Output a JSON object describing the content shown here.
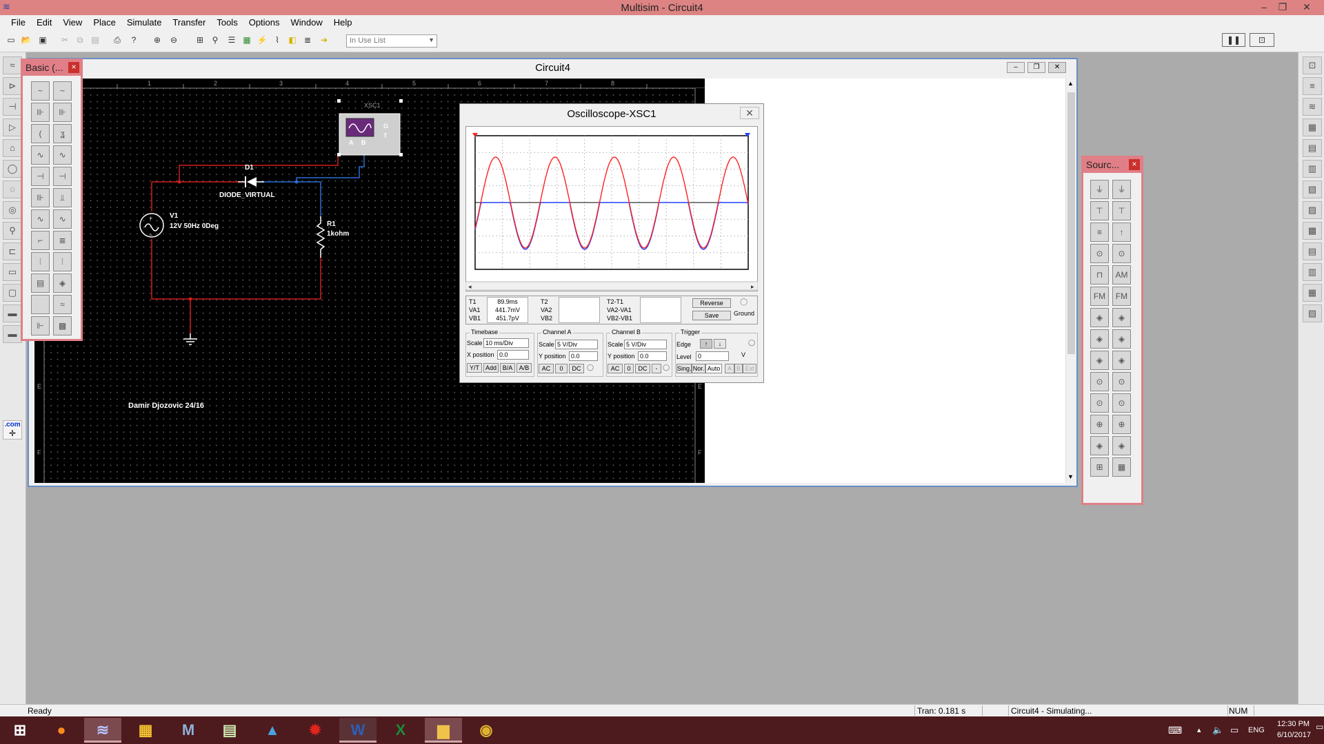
{
  "window": {
    "title": "Multisim - Circuit4",
    "min": "–",
    "restore": "❐",
    "close": "✕"
  },
  "menu": [
    "File",
    "Edit",
    "View",
    "Place",
    "Simulate",
    "Transfer",
    "Tools",
    "Options",
    "Window",
    "Help"
  ],
  "toolbar": {
    "in_use_list": "In Use List"
  },
  "left_strip": {
    "com_label": ".com"
  },
  "basic_palette": {
    "title": "Basic (...",
    "close": "×"
  },
  "sources_palette": {
    "title": "Sourc...",
    "close": "×"
  },
  "circuit_window": {
    "title": "Circuit4"
  },
  "ruler": {
    "top": [
      "1",
      "2",
      "3",
      "4",
      "5",
      "6",
      "7",
      "8"
    ],
    "left": [
      "E",
      "F"
    ],
    "right": [
      "E",
      "F"
    ]
  },
  "schematic": {
    "scope_ref": "XSC1",
    "scope_ch_a": "A",
    "scope_ch_b": "B",
    "scope_g": "G",
    "scope_t": "T",
    "diode_ref": "D1",
    "diode_value": "DIODE_VIRTUAL",
    "source_ref": "V1",
    "source_value": "12V 50Hz 0Deg",
    "res_ref": "R1",
    "res_value": "1kohm",
    "author": "Damir Djozovic 24/16"
  },
  "oscilloscope": {
    "title": "Oscilloscope-XSC1",
    "close": "✕",
    "readout": {
      "t1_label": "T1",
      "va1_label": "VA1",
      "vb1_label": "VB1",
      "t1": "89.9ms",
      "va1": "441.7mV",
      "vb1": "451.7pV",
      "t2_label": "T2",
      "va2_label": "VA2",
      "vb2_label": "VB2",
      "dt_label": "T2-T1",
      "dva_label": "VA2-VA1",
      "dvb_label": "VB2-VB1"
    },
    "reverse": "Reverse",
    "save": "Save",
    "ground": "Ground",
    "timebase": {
      "label": "Timebase",
      "scale_label": "Scale",
      "scale": "10 ms/Div",
      "xpos_label": "X position",
      "xpos": "0.0",
      "yt": "Y/T",
      "add": "Add",
      "ba": "B/A",
      "ab": "A/B"
    },
    "channel_a": {
      "label": "Channel A",
      "scale_label": "Scale",
      "scale": "5 V/Div",
      "ypos_label": "Y position",
      "ypos": "0.0",
      "ac": "AC",
      "zero": "0",
      "dc": "DC"
    },
    "channel_b": {
      "label": "Channel B",
      "scale_label": "Scale",
      "scale": "5 V/Div",
      "ypos_label": "Y position",
      "ypos": "0.0",
      "ac": "AC",
      "zero": "0",
      "dc": "DC",
      "minus": "-"
    },
    "trigger": {
      "label": "Trigger",
      "edge_label": "Edge",
      "level_label": "Level",
      "level": "0",
      "unit": "V",
      "sing": "Sing.",
      "nor": "Nor.",
      "auto": "Auto",
      "a": "A",
      "b": "B",
      "ext": "Ext"
    }
  },
  "status": {
    "left": "Ready",
    "tran": "Tran: 0.181 s",
    "sim": "Circuit4 - Simulating...",
    "num": "NUM"
  },
  "tray": {
    "lang": "ENG",
    "time": "12:30 PM",
    "date": "6/10/2017"
  },
  "colors": {
    "title_bar": "#dd8383",
    "palette": "#e07f87",
    "channel_a": "#ff2020",
    "channel_b": "#2040ff",
    "wire_red": "#d21f1f",
    "wire_blue": "#2a6fd6",
    "taskbar": "#4d1a1e"
  }
}
